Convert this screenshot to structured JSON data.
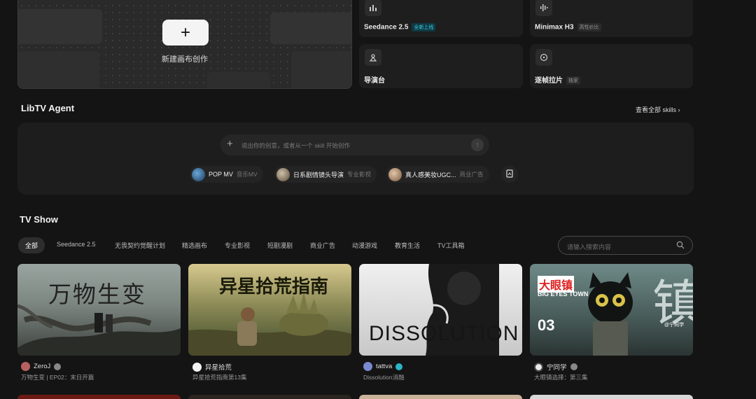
{
  "hero": {
    "new_canvas_label": "新建画布创作",
    "plus": "+"
  },
  "tiles": [
    {
      "name": "Seedance 2.5",
      "badge": "全新上线",
      "icon": "chart-bars-icon"
    },
    {
      "name": "Minimax H3",
      "badge": "高性价比",
      "icon": "waveform-icon"
    },
    {
      "name": "导演台",
      "badge": "",
      "icon": "director-icon"
    },
    {
      "name": "逐帧拉片",
      "badge": "独家",
      "icon": "film-analysis-icon"
    }
  ],
  "agent": {
    "title": "LibTV Agent",
    "view_all": "查看全部 skills",
    "prompt_placeholder": "说出你的创意，或者从一个 skill 开始创作",
    "chips": [
      {
        "label": "POP MV",
        "sub": "音乐MV"
      },
      {
        "label": "日系剧情镜头导演",
        "sub": "专业影视"
      },
      {
        "label": "真人感美妆UGC...",
        "sub": "商业广告"
      }
    ]
  },
  "tvshow": {
    "title": "TV Show",
    "tabs": [
      "全部",
      "Seedance 2.5",
      "无畏契约觉醒计划",
      "精选画布",
      "专业影视",
      "短剧漫剧",
      "商业广告",
      "动漫游戏",
      "教育生活",
      "TV工具箱"
    ],
    "search_placeholder": "请输入搜索内容"
  },
  "cards": [
    {
      "title_art": "万物生变",
      "user": "ZeroJ",
      "desc": "万物生变 | EP02：末日开篇"
    },
    {
      "title_art": "异星拾荒指南",
      "user": "异星拾荒",
      "desc": "异星拾荒指南第13集"
    },
    {
      "title_art": "DISSOLUTION",
      "user": "tattva",
      "desc": "Dissolution消融"
    },
    {
      "title_art": "大眼镇",
      "title_sub": "BIG EYES TOWN",
      "episode": "03",
      "signature": "@宁同学",
      "user": "宁同学",
      "desc": "大眼镇选择：第三集"
    }
  ]
}
